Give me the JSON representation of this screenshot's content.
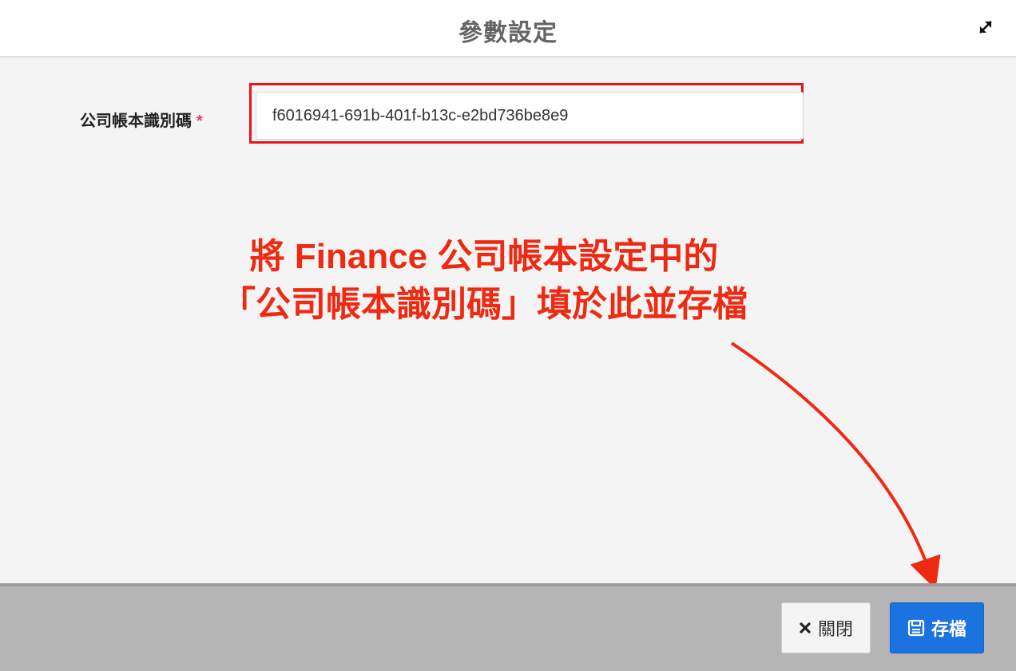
{
  "modal": {
    "title": "參數設定",
    "expand_icon": "expand-icon"
  },
  "form": {
    "field_label": "公司帳本識別碼",
    "required_mark": "*",
    "field_value": "f6016941-691b-401f-b13c-e2bd736be8e9"
  },
  "annotation": {
    "line1": "將 Finance 公司帳本設定中的",
    "line2": "「公司帳本識別碼」填於此並存檔",
    "color": "#ef2a12"
  },
  "footer": {
    "close_label": "關閉",
    "close_icon": "close-icon",
    "save_label": "存檔",
    "save_icon": "floppy-disk-icon",
    "save_color": "#1a73e0"
  }
}
